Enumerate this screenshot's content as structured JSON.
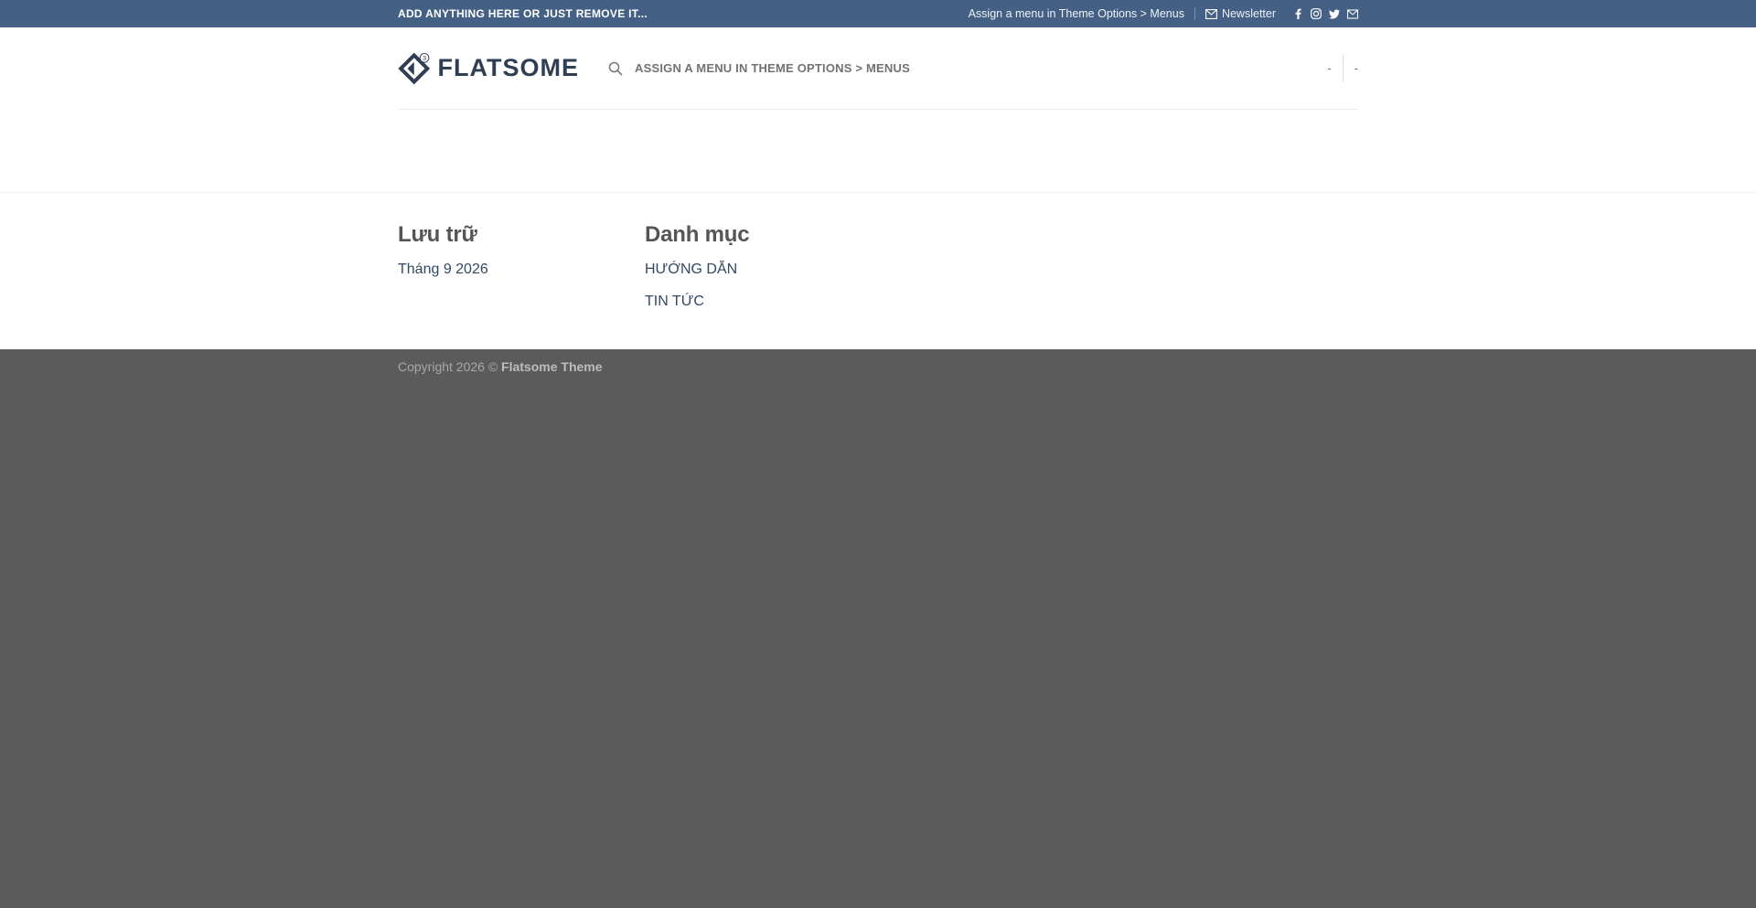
{
  "topbar": {
    "left_text": "ADD ANYTHING HERE OR JUST REMOVE IT...",
    "menu_text": "Assign a menu in Theme Options > Menus",
    "newsletter_label": "Newsletter",
    "socials": [
      "facebook-icon",
      "instagram-icon",
      "twitter-icon",
      "email-icon"
    ]
  },
  "header": {
    "logo_text": "FLATSOME",
    "nav_text": "ASSIGN A MENU IN THEME OPTIONS > MENUS",
    "right_items": [
      "-",
      "-"
    ]
  },
  "widgets": {
    "archive": {
      "title": "Lưu trữ",
      "items": [
        "Tháng 9 2026"
      ]
    },
    "categories": {
      "title": "Danh mục",
      "items": [
        "HƯỚNG DẪN",
        "TIN TỨC"
      ]
    }
  },
  "footer": {
    "copyright_prefix": "Copyright 2026 ©",
    "copyright_brand": "Flatsome Theme"
  },
  "colors": {
    "topbar": "#446084",
    "link": "#334862",
    "footer_bg": "#5b5b5b"
  }
}
